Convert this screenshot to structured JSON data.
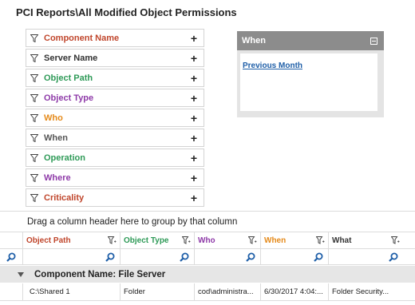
{
  "title": "PCI Reports\\All Modified Object Permissions",
  "filters": [
    {
      "label": "Component Name",
      "color": "#c0462c"
    },
    {
      "label": "Server Name",
      "color": "#333333"
    },
    {
      "label": "Object Path",
      "color": "#2e9a57"
    },
    {
      "label": "Object Type",
      "color": "#8e3aa8"
    },
    {
      "label": "Who",
      "color": "#e58a1a"
    },
    {
      "label": "When",
      "color": "#555555"
    },
    {
      "label": "Operation",
      "color": "#2e9a57"
    },
    {
      "label": "Where",
      "color": "#8e3aa8"
    },
    {
      "label": "Criticality",
      "color": "#c0462c"
    }
  ],
  "when_panel": {
    "title": "When",
    "link": "Previous Month"
  },
  "group_hint": "Drag a column header here to group by that column",
  "columns": [
    {
      "label": "Object Path",
      "color": "#c0462c"
    },
    {
      "label": "Object Type",
      "color": "#2e9a57"
    },
    {
      "label": "Who",
      "color": "#8e3aa8"
    },
    {
      "label": "When",
      "color": "#e58a1a"
    },
    {
      "label": "What",
      "color": "#333333"
    }
  ],
  "group_row": "Component Name: File Server",
  "row": [
    "C:\\Shared 1",
    "Folder",
    "cod\\administra...",
    "6/30/2017 4:04:...",
    "Folder Security..."
  ],
  "icons": {
    "filter": "funnel-icon",
    "add": "plus-icon",
    "search": "magnifier-icon",
    "expand": "triangle-down-icon",
    "collapse": "collapse-box-icon"
  },
  "accent": "#1f5fa8"
}
